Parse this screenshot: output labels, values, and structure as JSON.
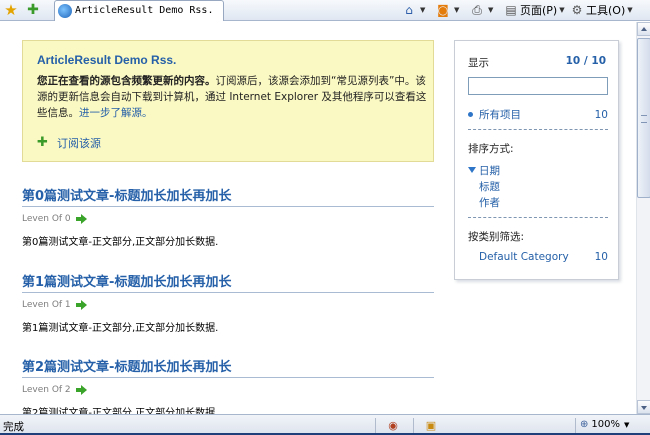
{
  "browser": {
    "tab_title": "ArticleResult Demo Rss.",
    "toolbar": {
      "page_label": "页面(P)",
      "tools_label": "工具(O)"
    },
    "status": {
      "text": "完成",
      "zoom": "100%"
    }
  },
  "feed": {
    "title": "ArticleResult Demo Rss.",
    "intro_bold": "您正在查看的源包含频繁更新的内容。",
    "intro_text": "订阅源后，该源会添加到“常见源列表”中。该源的更新信息会自动下载到计算机，通过 Internet Explorer 及其他程序可以查看这些信息。",
    "learn_more": "进一步了解源。",
    "subscribe_label": "订阅该源"
  },
  "articles": [
    {
      "title": "第0篇测试文章-标题加长加长再加长",
      "author": "Leven Of 0",
      "body": "第0篇测试文章-正文部分,正文部分加长数据."
    },
    {
      "title": "第1篇测试文章-标题加长加长再加长",
      "author": "Leven Of 1",
      "body": "第1篇测试文章-正文部分,正文部分加长数据."
    },
    {
      "title": "第2篇测试文章-标题加长加长再加长",
      "author": "Leven Of 2",
      "body": "第2篇测试文章-正文部分,正文部分加长数据."
    }
  ],
  "filter": {
    "display_label": "显示",
    "display_count": "10 / 10",
    "search_value": "",
    "all_items_label": "所有项目",
    "all_items_count": "10",
    "sort_label": "排序方式:",
    "sort_options": [
      "日期",
      "标题",
      "作者"
    ],
    "category_label": "按类别筛选:",
    "category_name": "Default Category",
    "category_count": "10"
  },
  "colors": {
    "link_blue": "#2560a8",
    "banner_bg": "#fbf9c3",
    "arrow_green": "#3aa32a"
  }
}
